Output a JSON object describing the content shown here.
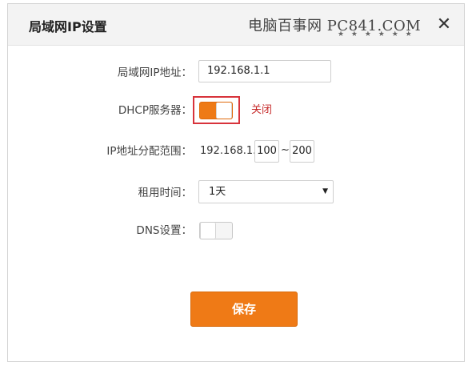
{
  "dialog": {
    "title": "局域网IP设置",
    "watermark": "电脑百事网 PC841.COM",
    "watermark_dots": "★ ★ ★ ★ ★ ★",
    "close_glyph": "✕"
  },
  "form": {
    "lan_ip": {
      "label": "局域网IP地址：",
      "value": "192.168.1.1"
    },
    "dhcp": {
      "label": "DHCP服务器：",
      "state": "on",
      "status_text": "关闭"
    },
    "ip_range": {
      "label": "IP地址分配范围：",
      "prefix": "192.168.1.",
      "start": "100",
      "separator": "~",
      "end": "200"
    },
    "lease_time": {
      "label": "租用时间：",
      "selected": "1天",
      "arrow": "▼"
    },
    "dns": {
      "label": "DNS设置：",
      "state": "off"
    }
  },
  "actions": {
    "save_label": "保存"
  },
  "colors": {
    "accent": "#ef7a16",
    "highlight": "#d8333b",
    "status": "#c62828"
  }
}
